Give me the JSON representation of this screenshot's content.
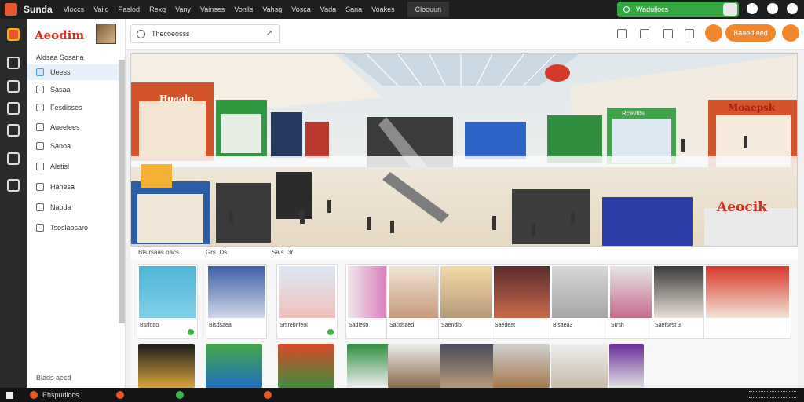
{
  "topbar": {
    "brand": "Sunda",
    "menu": [
      "Vloccs",
      "Vailo",
      "Paslod",
      "Rexg",
      "Vany",
      "Vainses",
      "Vonlls",
      "Vahsg",
      "Vosca",
      "Vada",
      "Sana",
      "Voakes"
    ],
    "active_tab": "Cloouun",
    "search_text": "Wadullocs"
  },
  "sidebar": {
    "logo": "Aeodim",
    "header": "Aldsaa Sosana",
    "items": [
      {
        "label": "Ueess",
        "selected": true
      },
      {
        "label": "Sasaa",
        "selected": false
      },
      {
        "label": "Fesdisses",
        "selected": false
      },
      {
        "label": "Aueelees",
        "selected": false
      },
      {
        "label": "Sanoa",
        "selected": false
      },
      {
        "label": "Aletisl",
        "selected": false
      },
      {
        "label": "Hanesa",
        "selected": false
      },
      {
        "label": "Naoda",
        "selected": false
      },
      {
        "label": "Tsoslaosaro",
        "selected": false
      }
    ],
    "footer": "Blads aecd"
  },
  "toolbar": {
    "search_value": "Thecoeosss",
    "primary_label": "Baaed eed"
  },
  "hero": {
    "store_signs": [
      "Hoaalo",
      "Moaepsk",
      "Aeocik",
      "Rcevtds"
    ]
  },
  "filters": {
    "left": "Bls rsaas oacs",
    "mid": "Grs. Ds",
    "right": "Sals. 3r"
  },
  "cards": [
    {
      "label": "Bsrfoao",
      "verified": true
    },
    {
      "label": "Bisdsaeal",
      "verified": false
    },
    {
      "label": "Srsrebnfeol",
      "verified": true
    },
    {
      "label": "Sadleso",
      "verified": false
    },
    {
      "label": "Sacdsaed",
      "verified": false
    },
    {
      "label": "Saendlo",
      "verified": false
    },
    {
      "label": "Saedeat",
      "verified": false
    },
    {
      "label": "Blsaea3",
      "verified": false
    },
    {
      "label": "Srrsh",
      "verified": false
    },
    {
      "label": "Saefsest 3",
      "verified": false
    }
  ],
  "taskbar": {
    "apps": [
      "Ehspudlocs",
      "",
      "",
      ""
    ]
  },
  "colors": {
    "accent_orange": "#f2862d",
    "brand_red": "#d1321f",
    "green": "#36a843",
    "dark": "#1e1e1e"
  }
}
